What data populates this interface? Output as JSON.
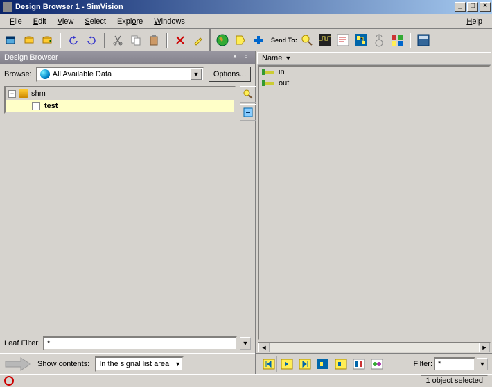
{
  "window": {
    "title": "Design Browser 1 - SimVision"
  },
  "menu": {
    "file": "File",
    "edit": "Edit",
    "view": "View",
    "select": "Select",
    "explore": "Explore",
    "windows": "Windows",
    "help": "Help"
  },
  "toolbar": {
    "sendto": "Send To:"
  },
  "pane": {
    "title": "Design Browser"
  },
  "browse": {
    "label": "Browse:",
    "combo": "All Available Data",
    "options": "Options..."
  },
  "tree": {
    "root": "shm",
    "child": "test"
  },
  "leaf": {
    "label": "Leaf Filter:",
    "value": "*"
  },
  "show": {
    "label": "Show contents:",
    "combo": "In the signal list area"
  },
  "list": {
    "header": "Name",
    "items": [
      "in",
      "out"
    ]
  },
  "filter": {
    "label": "Filter:",
    "value": "*"
  },
  "status": {
    "selected": "1 object selected"
  }
}
